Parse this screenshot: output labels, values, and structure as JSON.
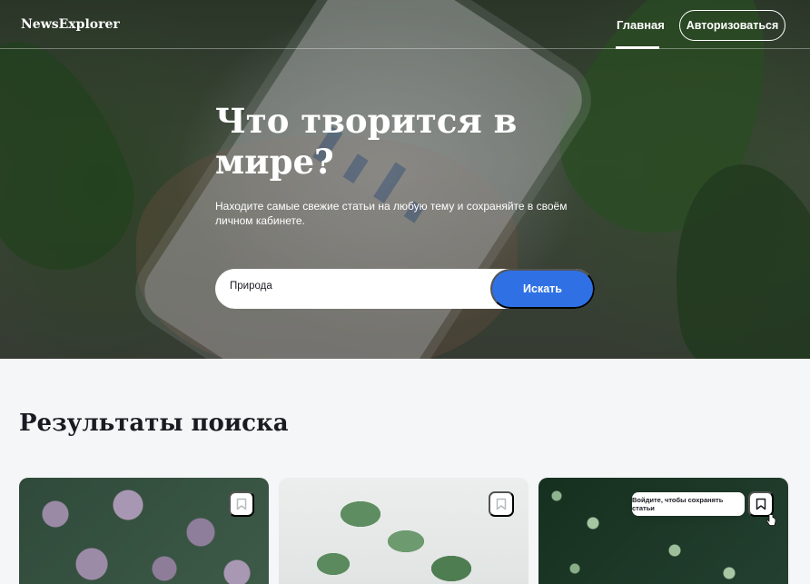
{
  "header": {
    "logo": "NewsExplorer",
    "nav_home": "Главная",
    "auth_button": "Авторизоваться"
  },
  "hero": {
    "title": "Что творится в мире?",
    "subtitle": "Находите самые свежие статьи на любую тему и сохраняйте в своём личном кабинете.",
    "search_value": "Природа",
    "search_button": "Искать"
  },
  "results": {
    "title": "Результаты поиска",
    "tooltip": "Войдите, чтобы сохранять статьи",
    "cards": [
      {
        "image": "purple-leaves"
      },
      {
        "image": "potted-ficus"
      },
      {
        "image": "round-green-leaves"
      }
    ]
  },
  "icons": {
    "bookmark": "bookmark-icon",
    "cursor": "hand-pointer-icon"
  },
  "colors": {
    "accent": "#2f71e5",
    "text_dark": "#1a1b22",
    "background": "#f5f6f7"
  }
}
